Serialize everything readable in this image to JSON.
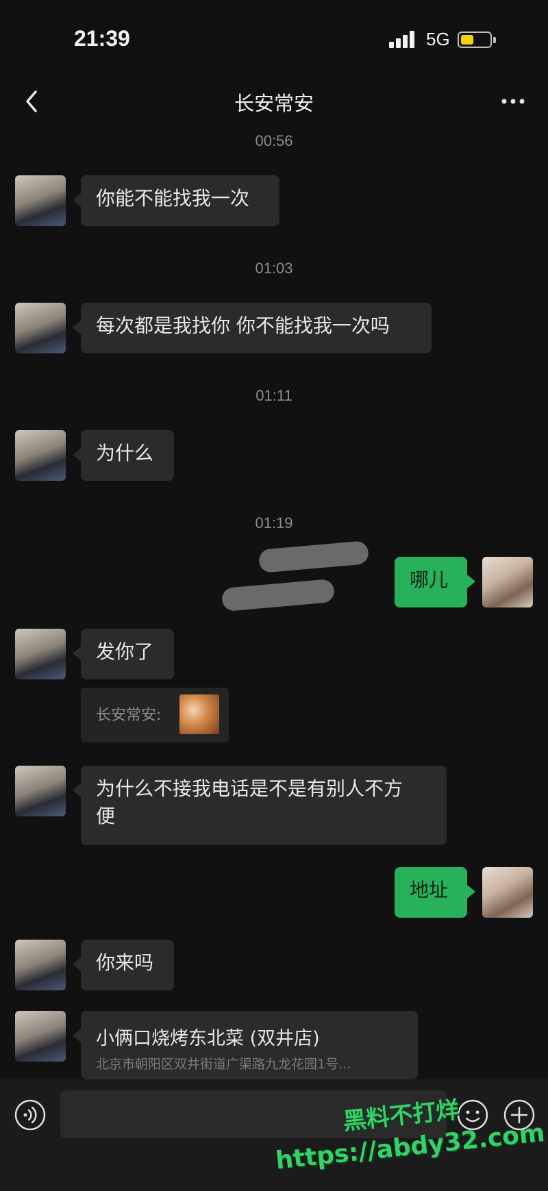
{
  "status_bar": {
    "time": "21:39",
    "network": "5G",
    "battery_level": 0.45,
    "battery_color": "#f5d300"
  },
  "nav": {
    "title": "长安常安",
    "back_icon": "chevron-left-icon",
    "more_icon": "more-dots-icon"
  },
  "timestamps": [
    "00:56",
    "01:03",
    "01:11",
    "01:19"
  ],
  "messages": [
    {
      "side": "left",
      "text": "你能不能找我一次"
    },
    {
      "side": "left",
      "text": "每次都是我找你 你不能找我一次吗"
    },
    {
      "side": "left",
      "text": "为什么"
    },
    {
      "side": "right",
      "text": "哪儿"
    },
    {
      "side": "left",
      "text": "发你了"
    },
    {
      "side": "left",
      "quote_label": "长安常安:"
    },
    {
      "side": "left",
      "text_line1": "为什么不接我电话是不是有别人不方",
      "text_line2": "便"
    },
    {
      "side": "right",
      "text": "地址"
    },
    {
      "side": "left",
      "text": "你来吗"
    }
  ],
  "location": {
    "name": "小俩口烧烤东北菜 (双井店)",
    "address": "北京市朝阳区双井街道广渠路九龙花园1号..."
  },
  "input_bar": {
    "voice_icon": "voice-icon",
    "emoji_icon": "emoji-icon",
    "plus_icon": "plus-circle-icon"
  },
  "watermark": {
    "line1": "黑料不打烊",
    "line2": "https://abdy32.com"
  },
  "colors": {
    "bubble_out": "#26b15a",
    "bubble_in": "#2b2b2b",
    "background": "#111111"
  }
}
